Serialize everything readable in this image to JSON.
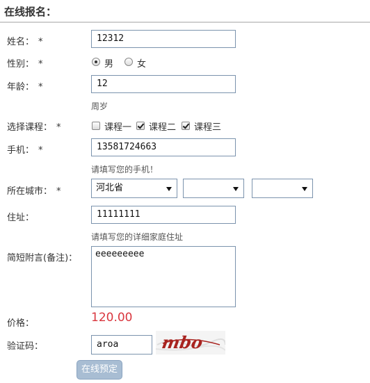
{
  "form": {
    "title": "在线报名：",
    "required_mark": "*",
    "name": {
      "label": "姓名：",
      "value": "12312"
    },
    "gender": {
      "label": "性别：",
      "options": [
        {
          "label": "男",
          "selected": true
        },
        {
          "label": "女",
          "selected": false
        }
      ]
    },
    "age": {
      "label": "年龄：",
      "value": "12",
      "unit": "周岁"
    },
    "courses": {
      "label": "选择课程：",
      "options": [
        {
          "label": "课程一",
          "checked": false
        },
        {
          "label": "课程二",
          "checked": true
        },
        {
          "label": "课程三",
          "checked": true
        }
      ]
    },
    "phone": {
      "label": "手机：",
      "value": "13581724663",
      "hint": "请填写您的手机！"
    },
    "city": {
      "label": "所在城市：",
      "province": "河北省",
      "city": "",
      "district": ""
    },
    "address": {
      "label": "住址：",
      "value": "11111111",
      "hint": "请填写您的详细家庭住址"
    },
    "note": {
      "label": "简短附言(备注)：",
      "value": "eeeeeeeee"
    },
    "price": {
      "label": "价格：",
      "value": "120.00"
    },
    "captcha": {
      "label": "验证码：",
      "value": "aroa",
      "image_text": "mbo"
    },
    "submit_label": "在线预定"
  },
  "colors": {
    "price": "#d9363e",
    "border": "#7b93ad",
    "button": "#a8bdd3"
  }
}
